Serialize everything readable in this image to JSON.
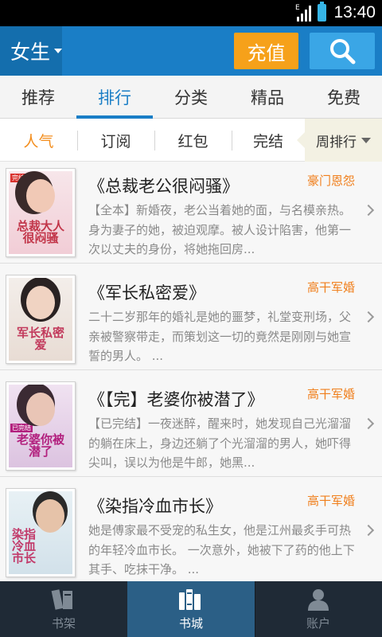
{
  "status_bar": {
    "time": "13:40",
    "network_label": "E",
    "icons": [
      "signal-icon",
      "battery-icon"
    ]
  },
  "header": {
    "gender_selector": "女生",
    "recharge_label": "充值",
    "search_icon": "search-icon"
  },
  "main_tabs": [
    {
      "label": "推荐",
      "active": false
    },
    {
      "label": "排行",
      "active": true
    },
    {
      "label": "分类",
      "active": false
    },
    {
      "label": "精品",
      "active": false
    },
    {
      "label": "免费",
      "active": false
    }
  ],
  "sub_tabs": [
    {
      "label": "人气",
      "active": true
    },
    {
      "label": "订阅",
      "active": false
    },
    {
      "label": "红包",
      "active": false
    },
    {
      "label": "完结",
      "active": false
    }
  ],
  "rank_period": "周排行",
  "books": [
    {
      "title": "《总裁老公很闷骚》",
      "genre": "豪门恩怨",
      "description": "【全本】新婚夜，老公当着她的面，与名模亲热。身为妻子的她，被迫观摩。被人设计陷害，他第一次以丈夫的身份，将她拖回房...",
      "cover_title": "总裁大人很闷骚",
      "cover_tag": "完结",
      "cover_colors": {
        "bg": "#f4d9de",
        "accent": "#c2364a",
        "face": "#f1c9b6"
      }
    },
    {
      "title": "《军长私密爱》",
      "genre": "高干军婚",
      "description": "二十二岁那年的婚礼是她的噩梦，礼堂变刑场，父亲被警察带走，而策划这一切的竟然是刚刚与她宣誓的男人。 ...",
      "cover_title": "军长私密爱",
      "cover_tag": "",
      "cover_colors": {
        "bg": "#efe7e1",
        "accent": "#c23a5c",
        "face": "#f0d3c2"
      }
    },
    {
      "title": "《【完】老婆你被潜了》",
      "genre": "高干军婚",
      "description": "【已完结】一夜迷醉，醒来时，她发现自己光溜溜的躺在床上，身边还躺了个光溜溜的男人，她吓得尖叫，误以为他是牛郎，她黑...",
      "cover_title": "老婆你被潜了",
      "cover_tag": "已完结",
      "cover_colors": {
        "bg": "#ead9ec",
        "accent": "#b2207e",
        "face": "#e9c5b6"
      }
    },
    {
      "title": "《染指冷血市长》",
      "genre": "高干军婚",
      "description": "她是傅家最不受宠的私生女，他是江州最炙手可热的年轻冷血市长。 一次意外，她被下了药的他上下其手、吃抹干净。 ...",
      "cover_title": "染指冷血市长",
      "cover_tag": "",
      "cover_colors": {
        "bg": "#e1ecf2",
        "accent": "#c23a6a",
        "face": "#e6c3a9"
      }
    }
  ],
  "bottom_nav": [
    {
      "label": "书架",
      "icon": "bookshelf-icon",
      "active": false
    },
    {
      "label": "书城",
      "icon": "bookstore-icon",
      "active": true
    },
    {
      "label": "账户",
      "icon": "account-icon",
      "active": false
    }
  ]
}
